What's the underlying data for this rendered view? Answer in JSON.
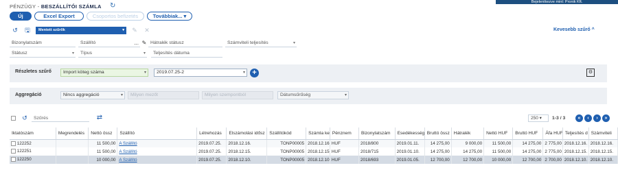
{
  "top_banner": "Bejelentkezve mint: Pronik Kft.",
  "breadcrumb": {
    "section": "PÉNZÜGY",
    "separator": " - ",
    "page": "BESZÁLLÍTÓI SZÁMLA"
  },
  "toolbar": {
    "new_label": "Új",
    "excel_label": "Excel Export",
    "group_label": "Csoportos befizetés",
    "more_label": "Továbbiak..."
  },
  "filter_bar": {
    "saved_filter": "Mentett szűrők",
    "toggle_label": "Kevesebb szűrő ^"
  },
  "filters": {
    "invoice_no": "Bizonylatszám",
    "supplier": "Szállító",
    "supplier_dots": "...",
    "overdue": "Hátralék státusz",
    "accounting": "Számviteli teljesítés",
    "status": "Státusz",
    "type": "Típus",
    "fulfil_date": "Teljesítés dátuma"
  },
  "detail_filter": {
    "label": "Részletes szűrő",
    "field": "Import köteg száma",
    "value": "2019.07.25-2"
  },
  "aggregation": {
    "label": "Aggregáció",
    "value": "Nincs aggregáció",
    "metric_placeholder": "Milyen mezőt",
    "dim_placeholder": "Milyen szempontból",
    "date_density": "Dátumsűrűség"
  },
  "list_toolbar": {
    "search_placeholder": "Szűrés",
    "page_size": "250",
    "page_info": "1-3 / 3"
  },
  "table": {
    "columns": [
      "Iktatószám",
      "Megrendelés",
      "Nettó össz",
      "Szállító",
      "Létrehozás",
      "Elszámolási idősz",
      "Szállítókód",
      "Számla kelt",
      "Pénznem",
      "Bizonylatszám",
      "Esedékesség",
      "Bruttó össz",
      "Hátralék",
      "Nettó HUF",
      "Bruttó HUF",
      "Áfa HUF",
      "Teljesítés d",
      "Számviteli"
    ],
    "rows": [
      [
        "122252",
        "",
        "11 500,00",
        "A Szállító",
        "2019.07.25.",
        "2018.12.16.",
        "TONP00005",
        "2018.12.16.",
        "HUF",
        "2018/800",
        "2019.01.11.",
        "14 275,00",
        "9 000,00",
        "11 500,00",
        "14 275,00",
        "2 775,00",
        "2018.12.16.",
        "2018.12.16."
      ],
      [
        "122251",
        "",
        "11 500,00",
        "A Szállító",
        "2019.07.25.",
        "2018.12.15.",
        "TONP00005",
        "2018.12.15.",
        "HUF",
        "2018/715",
        "2019.01.10.",
        "14 275,00",
        "14 275,00",
        "11 500,00",
        "14 275,00",
        "2 775,00",
        "2018.12.15.",
        "2018.12.15."
      ],
      [
        "122250",
        "",
        "10 000,00",
        "A Szállító",
        "2019.07.25.",
        "2018.12.10.",
        "TONP00005",
        "2018.12.10.",
        "HUF",
        "2018/693",
        "2019.01.05.",
        "12 700,00",
        "12 700,00",
        "10 000,00",
        "12 700,00",
        "2 700,00",
        "2018.12.10.",
        "2018.12.10."
      ]
    ]
  },
  "colors": {
    "primary": "#1f5fb0",
    "band": "#edf0f4",
    "topbar": "#1d4f80"
  }
}
